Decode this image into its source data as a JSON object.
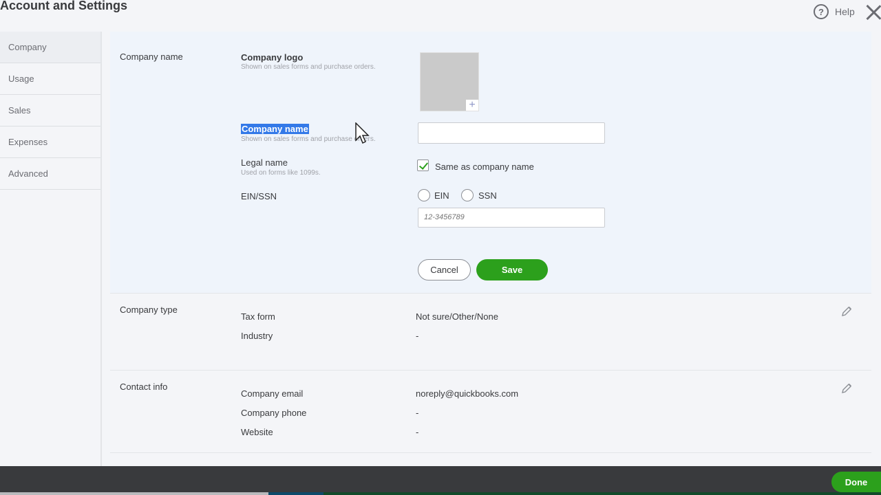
{
  "header": {
    "title": "Account and Settings",
    "help_label": "Help",
    "help_glyph": "?"
  },
  "sidebar": {
    "items": [
      {
        "label": "Company",
        "active": true
      },
      {
        "label": "Usage"
      },
      {
        "label": "Sales"
      },
      {
        "label": "Expenses"
      },
      {
        "label": "Advanced"
      }
    ]
  },
  "company_name_section": {
    "section_label": "Company name",
    "logo": {
      "label": "Company logo",
      "sub": "Shown on sales forms and purchase orders.",
      "add_glyph": "+"
    },
    "company_name": {
      "label": "Company name",
      "sub": "Shown on sales forms and purchase orders.",
      "value": ""
    },
    "legal_name": {
      "label": "Legal name",
      "sub": "Used on forms like 1099s.",
      "checkbox_label": "Same as company name",
      "checked": true
    },
    "ein_ssn": {
      "label": "EIN/SSN",
      "options": [
        "EIN",
        "SSN"
      ],
      "placeholder": "12-3456789"
    },
    "cancel_label": "Cancel",
    "save_label": "Save"
  },
  "company_type_section": {
    "section_label": "Company type",
    "rows": [
      {
        "key": "Tax form",
        "value": "Not sure/Other/None"
      },
      {
        "key": "Industry",
        "value": "-"
      }
    ]
  },
  "contact_info_section": {
    "section_label": "Contact info",
    "rows": [
      {
        "key": "Company email",
        "value": "noreply@quickbooks.com"
      },
      {
        "key": "Company phone",
        "value": "-"
      },
      {
        "key": "Website",
        "value": "-"
      }
    ]
  },
  "footer": {
    "done_label": "Done"
  },
  "colors": {
    "accent_green": "#2ca01c",
    "selection_blue": "#3379e8",
    "footer_bg": "#393a3d"
  }
}
